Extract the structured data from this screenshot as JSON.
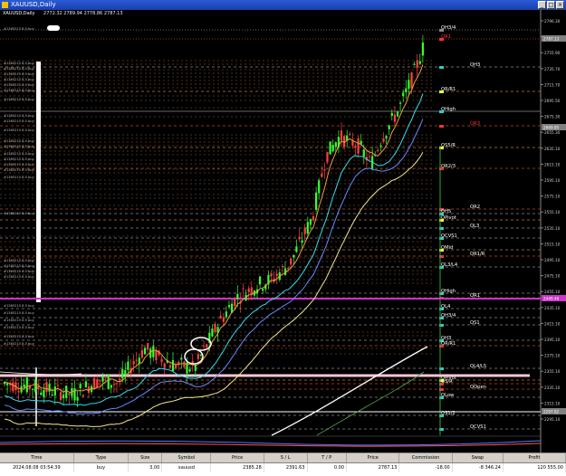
{
  "window": {
    "title": "XAUUSD,Daily"
  },
  "chart_header": {
    "symbol": "XAUUSD,Daily",
    "ohlc": "2772.32 2789.94 2778.86 2787.13"
  },
  "price_axis": {
    "ticks": [
      "2796.30",
      "2775.90",
      "2755.90",
      "2735.70",
      "2715.70",
      "2695.50",
      "2675.30",
      "2655.30",
      "2635.10",
      "2615.10",
      "2595.10",
      "2575.10",
      "2555.10",
      "2535.10",
      "2515.10",
      "2495.10",
      "2475.10",
      "2455.10",
      "2435.10",
      "2415.10",
      "2395.10",
      "2375.10",
      "2355.10",
      "2335.10",
      "2315.10",
      "2295.10"
    ],
    "price_labels": [
      {
        "text": "2787.13",
        "color": "#808080"
      },
      {
        "text": "2669.85",
        "color": "#808080"
      },
      {
        "text": "2449.46",
        "color": "#cc33cc"
      },
      {
        "text": "2297.82",
        "color": "#808080"
      }
    ]
  },
  "levels": [
    {
      "label": "QH3/4",
      "color": "#ffffff",
      "marker": "#888888",
      "style": "dot"
    },
    {
      "label": "QR1",
      "color": "#ff3333",
      "marker": "#ff3333",
      "style": "dot"
    },
    {
      "label": "QH3",
      "color": "#ffffff",
      "marker": "#33cccc",
      "style": "dash"
    },
    {
      "label": "QR/R1",
      "color": "#ffffff",
      "marker": "#ffff33",
      "style": "dash"
    },
    {
      "label": "QHigh",
      "color": "#ffffff",
      "marker": "#33cccc",
      "style": "solid"
    },
    {
      "label": "QR3",
      "color": "#ff3333",
      "marker": "#ff3333",
      "style": "dash"
    },
    {
      "label": "QS5/R",
      "color": "#ffffff",
      "marker": "#ffff33",
      "style": "dash"
    },
    {
      "label": "QR2/3",
      "color": "#ffffff",
      "marker": "#ff3333",
      "style": "dash"
    },
    {
      "label": "QR2",
      "color": "#ffffff",
      "marker": "#ff3333",
      "style": "dash"
    },
    {
      "label": "QH5",
      "color": "#ffffff",
      "marker": "#33cccc",
      "style": "dash"
    },
    {
      "label": "QPivot",
      "color": "#ffffff",
      "marker": "#ffff33",
      "style": "dash"
    },
    {
      "label": "QL3",
      "color": "#ffffff",
      "marker": "#33cccc",
      "style": "dash"
    },
    {
      "label": "QCVS1",
      "color": "#ffffff",
      "marker": "#33cccc",
      "style": "dash"
    },
    {
      "label": "QMid",
      "color": "#ffffff",
      "marker": "#ffff33",
      "style": "dash"
    },
    {
      "label": "QR1/R",
      "color": "#ffffff",
      "marker": "#ff3333",
      "style": "dash"
    },
    {
      "label": "QL3/L4",
      "color": "#ffffff",
      "marker": "#33cccc",
      "style": "dash"
    },
    {
      "label": "QHigh",
      "color": "#ffffff",
      "marker": "#33cccc",
      "style": "dash"
    },
    {
      "label": "QR1",
      "color": "#ffffff",
      "marker": "#ff3333",
      "style": "dash"
    },
    {
      "label": "QL4",
      "color": "#ffffff",
      "marker": "#33cccc",
      "style": "dash"
    },
    {
      "label": "QH3/4",
      "color": "#ffffff",
      "marker": "#33cccc",
      "style": "dash"
    },
    {
      "label": "QS1",
      "color": "#ffffff",
      "marker": "#33cccc",
      "style": "dash"
    },
    {
      "label": "QH3",
      "color": "#ffffff",
      "marker": "#33cccc",
      "style": "dash"
    },
    {
      "label": "QR/R1",
      "color": "#ffffff",
      "marker": "#ff3333",
      "style": "dash"
    },
    {
      "label": "QL4/L5",
      "color": "#ffffff",
      "marker": "#33cccc",
      "style": "dash"
    },
    {
      "label": "QPivot",
      "color": "#ffffff",
      "marker": "#ffff33",
      "style": "dash"
    },
    {
      "label": "QS/R",
      "color": "#ffffff",
      "marker": "#ff3333",
      "style": "dash"
    },
    {
      "label": "QOpen",
      "color": "#ffffff",
      "marker": "#ff3333",
      "style": "dash"
    },
    {
      "label": "QLow",
      "color": "#ffffff",
      "marker": "#33cccc",
      "style": "dash"
    },
    {
      "label": "QS1/2",
      "color": "#ffffff",
      "marker": "#33cccc",
      "style": "dash"
    },
    {
      "label": "QCVS1",
      "color": "#ffffff",
      "marker": "#33cccc",
      "style": "dash"
    }
  ],
  "colors": {
    "candle_up": "#33ff33",
    "candle_down": "#ff4040",
    "ma_orange": "#e8a040",
    "ma_cyan": "#33ddee",
    "ma_blue": "#6688ff",
    "ma_yellow": "#f2e88a",
    "ma_white": "#ffffff",
    "ma_green": "#55aa55",
    "magenta_line": "#cc33cc",
    "pink_line": "#f6c6d6",
    "white_hline": "#ffffff"
  },
  "chart_data": {
    "type": "candlestick",
    "symbol": "XAUUSD",
    "timeframe": "Daily",
    "ylim": [
      2290,
      2800
    ],
    "last": {
      "open": 2772.32,
      "high": 2789.94,
      "low": 2778.86,
      "close": 2787.13
    }
  },
  "trade_table": {
    "headers": [
      "Time",
      "Type",
      "Size",
      "Symbol",
      "Price",
      "S / L",
      "T / P",
      "Price",
      "Commission",
      "Swap",
      "Profit"
    ],
    "row": [
      "2024.08.08 03:54:39",
      "buy",
      "3.00",
      "xauusd",
      "2385.28",
      "2391.63",
      "0.00",
      "2787.13",
      "-18.00",
      "-8 346.24",
      "120 555.00"
    ]
  }
}
